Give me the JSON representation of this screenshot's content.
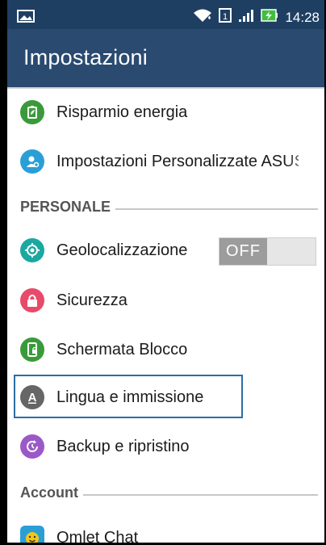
{
  "status_bar": {
    "time": "14:28",
    "icons": [
      "image-icon",
      "wifi-icon",
      "sim-icon",
      "signal-icon",
      "battery-charging-icon"
    ]
  },
  "action_bar": {
    "title": "Impostazioni"
  },
  "items": {
    "risparmio": {
      "label": "Risparmio energia",
      "icon": "battery-leaf-icon",
      "color": "#3a9a3a"
    },
    "personalizzate": {
      "label": "Impostazioni Personalizzate ASUS",
      "icon": "user-settings-icon",
      "color": "#2a9fd6"
    },
    "geolocalizzazione": {
      "label": "Geolocalizzazione",
      "icon": "location-icon",
      "color": "#1aa8a0",
      "toggle": "OFF"
    },
    "sicurezza": {
      "label": "Sicurezza",
      "icon": "lock-icon",
      "color": "#e84a6a"
    },
    "schermata": {
      "label": "Schermata Blocco",
      "icon": "phone-lock-icon",
      "color": "#3a9a3a"
    },
    "lingua": {
      "label": "Lingua e immissione",
      "icon": "language-icon",
      "color": "#666666"
    },
    "backup": {
      "label": "Backup e ripristino",
      "icon": "backup-icon",
      "color": "#9b59c8"
    },
    "omlet": {
      "label": "Omlet Chat",
      "icon": "omlet-icon",
      "color": "#f5c518"
    }
  },
  "sections": {
    "personale": "PERSONALE",
    "account": "Account"
  }
}
